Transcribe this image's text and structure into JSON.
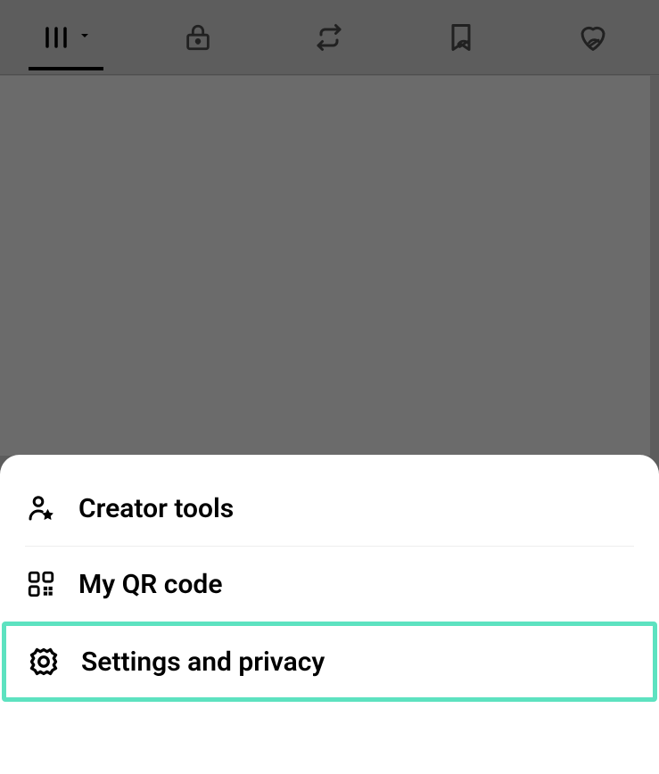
{
  "tabs": {
    "items": [
      {
        "name": "grid",
        "active": true
      },
      {
        "name": "private",
        "active": false
      },
      {
        "name": "reposts",
        "active": false
      },
      {
        "name": "saved",
        "active": false
      },
      {
        "name": "liked",
        "active": false
      }
    ]
  },
  "sheet": {
    "items": [
      {
        "icon": "person-star",
        "label": "Creator tools"
      },
      {
        "icon": "qr-code",
        "label": "My QR code"
      },
      {
        "icon": "gear",
        "label": "Settings and privacy",
        "highlighted": true
      }
    ]
  }
}
